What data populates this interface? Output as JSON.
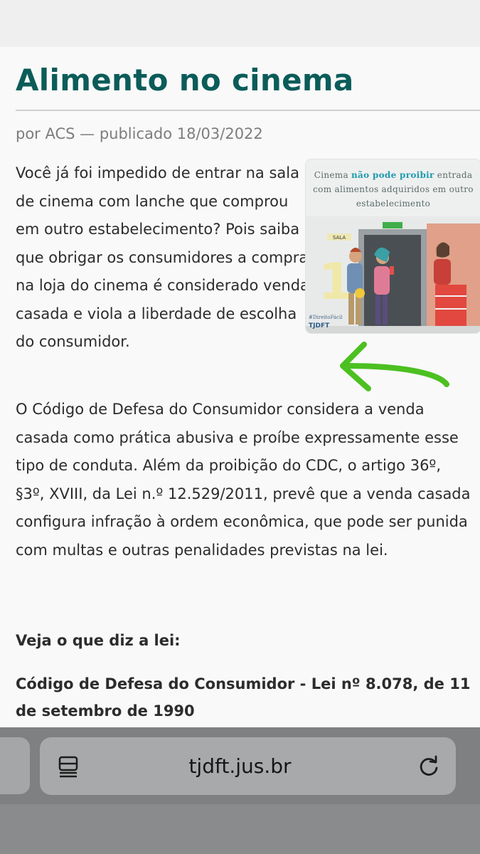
{
  "article": {
    "title": "Alimento no cinema",
    "byline": "por ACS — publicado 18/03/2022",
    "intro": "Você já foi impedido de entrar na sala de cinema com lanche que comprou em outro estabelecimento? Pois saiba que obrigar os consumidores a comprar na loja do cinema é considerado venda casada e viola a liberdade de escolha do consumidor.",
    "paragraph2": "O Código de Defesa do Consumidor considera a venda casada como prática abusiva e proíbe expressamente esse tipo de conduta. Além da proibição do CDC, o artigo 36º, §3º, XVIII, da Lei n.º 12.529/2011, prevê que a venda casada configura infração à ordem econômica, que pode ser punida com multas e outras penalidades previstas na lei.",
    "law_heading": "Veja o que diz a lei:",
    "cdc_heading": "Código de Defesa do Consumidor - Lei nº 8.078, de 11 de setembro de 1990"
  },
  "illustration": {
    "caption_pre": "Cinema",
    "caption_highlight": "não pode proibir",
    "caption_post": "entrada com alimentos adquiridos em outro estabelecimento",
    "room_sign": "SALA",
    "room_number": "1",
    "hashtag": "#DireitoFácil",
    "logo": "TJDFT",
    "highlight_color": "#1e9ab0"
  },
  "annotation": {
    "arrow_color": "#4cc021"
  },
  "browser": {
    "url": "tjdft.jus.br",
    "reader_icon": "reader-mode-icon",
    "reload_icon": "reload-icon"
  }
}
